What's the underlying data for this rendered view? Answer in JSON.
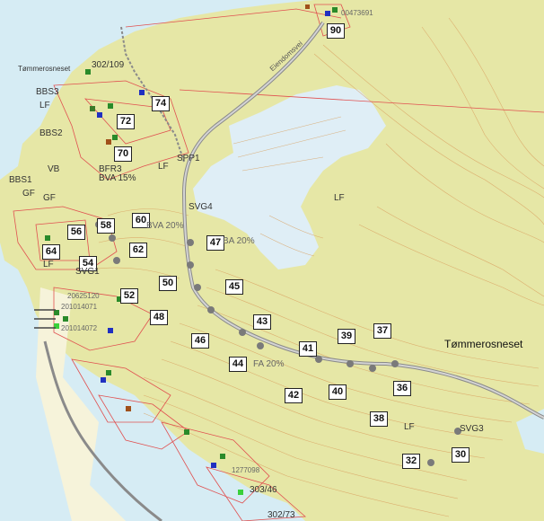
{
  "place_name": "Tømmerosneset",
  "place_name_small": "Tømmerosneset",
  "road_label": "Eiendomsvei",
  "plot_numbers": [
    "90",
    "74",
    "72",
    "70",
    "60",
    "58",
    "56",
    "64",
    "54",
    "62",
    "47",
    "50",
    "52",
    "45",
    "48",
    "46",
    "43",
    "41",
    "39",
    "37",
    "44",
    "42",
    "40",
    "36",
    "38",
    "32",
    "30"
  ],
  "zone_labels": {
    "bbs3": "BBS3",
    "bbs2": "BBS2",
    "bbs1": "BBS1",
    "lf_a": "LF",
    "lf_b": "LF",
    "lf_c": "LF",
    "lf_d": "LF",
    "lf_e": "LF",
    "vb": "VB",
    "gf_a": "GF",
    "gf_b": "GF",
    "bfr": "BFR3",
    "bva": "BVA 15%",
    "spp1": "SPP1",
    "svg4": "SVG4",
    "svg1": "SVG1",
    "svg3": "SVG3",
    "bva_20": "BVA 20%",
    "ba_20": "BA 20%",
    "fa_20": "FA 20%"
  },
  "gnr_labels": [
    "302/109",
    "20625120",
    "201014071",
    "201014072",
    "1277098",
    "00473691",
    "303/46",
    "302/73"
  ],
  "colors": {
    "land": "#e6e7a6",
    "water": "#d6ecf4",
    "marsh": "#dfeef6",
    "contour": "#d9a060",
    "plan_boundary": "#e05050",
    "road": "#8a8a8a"
  }
}
